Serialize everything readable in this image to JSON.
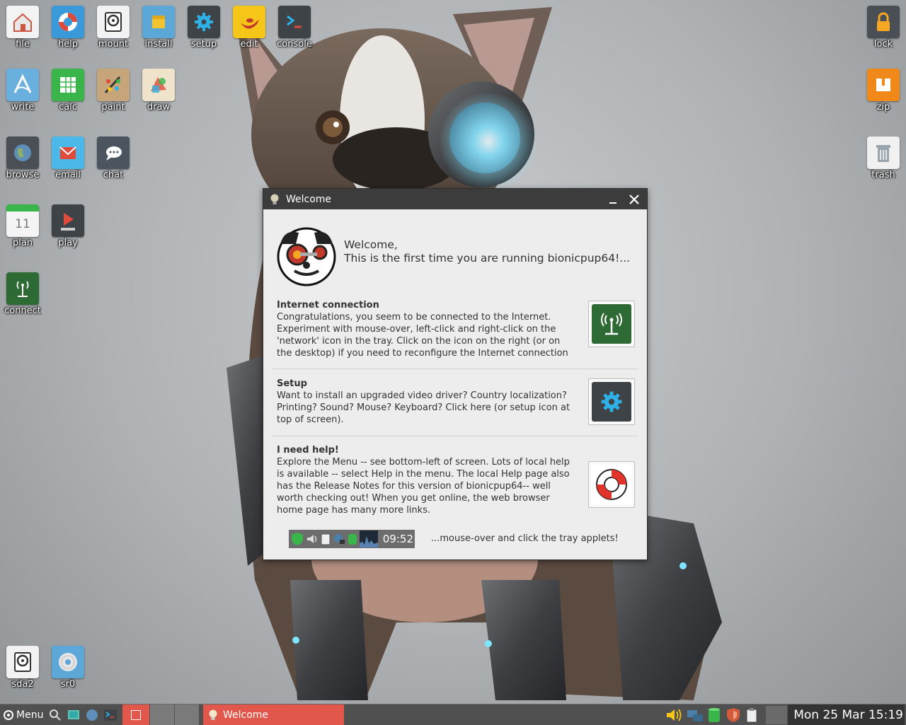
{
  "desktop": {
    "icons_top": [
      {
        "label": "file",
        "icon": "home-file-icon"
      },
      {
        "label": "help",
        "icon": "lifebuoy-icon"
      },
      {
        "label": "mount",
        "icon": "harddisk-icon"
      },
      {
        "label": "install",
        "icon": "package-icon"
      },
      {
        "label": "setup",
        "icon": "gear-icon"
      },
      {
        "label": "edit",
        "icon": "genie-lamp-icon"
      },
      {
        "label": "console",
        "icon": "terminal-icon"
      }
    ],
    "icons_row2": [
      {
        "label": "write",
        "icon": "write-icon"
      },
      {
        "label": "calc",
        "icon": "spreadsheet-icon"
      },
      {
        "label": "paint",
        "icon": "paint-palette-icon"
      },
      {
        "label": "draw",
        "icon": "draw-icon"
      }
    ],
    "icons_row3": [
      {
        "label": "browse",
        "icon": "globe-icon"
      },
      {
        "label": "email",
        "icon": "envelope-icon"
      },
      {
        "label": "chat",
        "icon": "chat-bubble-icon"
      }
    ],
    "icons_row4": [
      {
        "label": "plan",
        "icon": "calendar-icon",
        "day": "11"
      },
      {
        "label": "play",
        "icon": "media-play-icon"
      }
    ],
    "connect": {
      "label": "connect",
      "icon": "antenna-icon"
    },
    "drives": [
      {
        "label": "sda2",
        "icon": "harddisk-icon"
      },
      {
        "label": "sr0",
        "icon": "optical-disc-icon"
      }
    ],
    "right": [
      {
        "label": "lock",
        "icon": "padlock-icon"
      },
      {
        "label": "zip",
        "icon": "archive-icon"
      },
      {
        "label": "trash",
        "icon": "trash-icon"
      }
    ]
  },
  "window": {
    "title": "Welcome",
    "greeting_line1": "Welcome,",
    "greeting_line2": "This is the first time you are running bionicpup64!...",
    "internet": {
      "heading": "Internet connection",
      "body": "Congratulations, you seem to be connected to the Internet. Experiment with mouse-over, left-click and right-click on the 'network' icon in the tray. Click on the icon on the right (or on the desktop) if you need to reconfigure the Internet connection"
    },
    "setup": {
      "heading": "Setup",
      "body": "Want to install an upgraded video driver? Country localization? Printing? Sound? Mouse? Keyboard? Click here (or setup icon at top of screen)."
    },
    "help": {
      "heading": "I need help!",
      "body": "Explore the Menu -- see bottom-left of screen. Lots of local help is available -- select Help in the menu. The local Help page also has the Release Notes for this version of bionicpup64-- well worth checking out! When you get online, the web browser home page has many more links."
    },
    "tray_clock": "09:52",
    "tray_note": "...mouse-over and click the tray applets!"
  },
  "taskbar": {
    "menu_label": "Menu",
    "task_label": "Welcome",
    "clock": "Mon 25 Mar 15:19"
  },
  "colors": {
    "accent_task": "#e2574c",
    "green_button": "#2e6b34",
    "titlebar": "#3c3c3c",
    "taskbar": "#505050"
  }
}
